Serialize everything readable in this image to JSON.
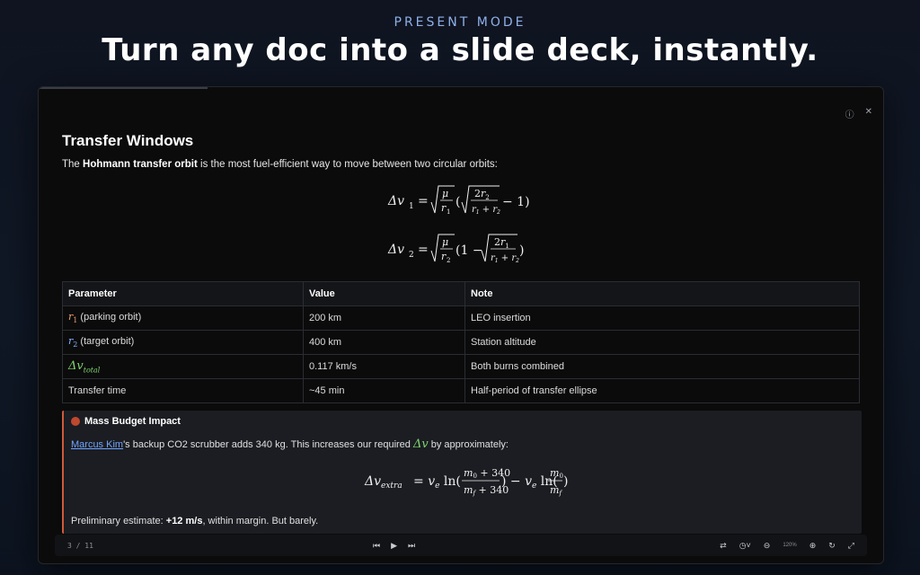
{
  "hero": {
    "eyebrow": "PRESENT MODE",
    "headline": "Turn any doc into a slide deck, instantly."
  },
  "slide": {
    "title": "Transfer Windows",
    "intro_prefix": "The ",
    "intro_bold": "Hohmann transfer orbit",
    "intro_suffix": " is the most fuel-efficient way to move between two circular orbits:",
    "table": {
      "headers": [
        "Parameter",
        "Value",
        "Note"
      ],
      "rows": [
        {
          "param_label": "(parking orbit)",
          "value": "200 km",
          "note": "LEO insertion"
        },
        {
          "param_label": "(target orbit)",
          "value": "400 km",
          "note": "Station altitude"
        },
        {
          "param_label": "",
          "value": "0.117 km/s",
          "note": "Both burns combined"
        },
        {
          "param_label": "Transfer time",
          "value": "~45 min",
          "note": "Half-period of transfer ellipse"
        }
      ]
    },
    "callout": {
      "title": "Mass Budget Impact",
      "link": "Marcus Kim",
      "body_mid": "'s backup CO2 scrubber adds 340 kg. This increases our required ",
      "body_end": " by approximately:",
      "est_prefix": "Preliminary estimate: ",
      "est_bold": "+12 m/s",
      "est_suffix": ", within margin. But barely."
    }
  },
  "toolbar": {
    "counter": "3 / 11",
    "zoom": "120%"
  },
  "colors": {
    "accent_link": "#6fa4ff",
    "callout_border": "#d05a3c",
    "r1": "#f0a070",
    "r2": "#88b4ff",
    "delta_v": "#7fd46f"
  }
}
